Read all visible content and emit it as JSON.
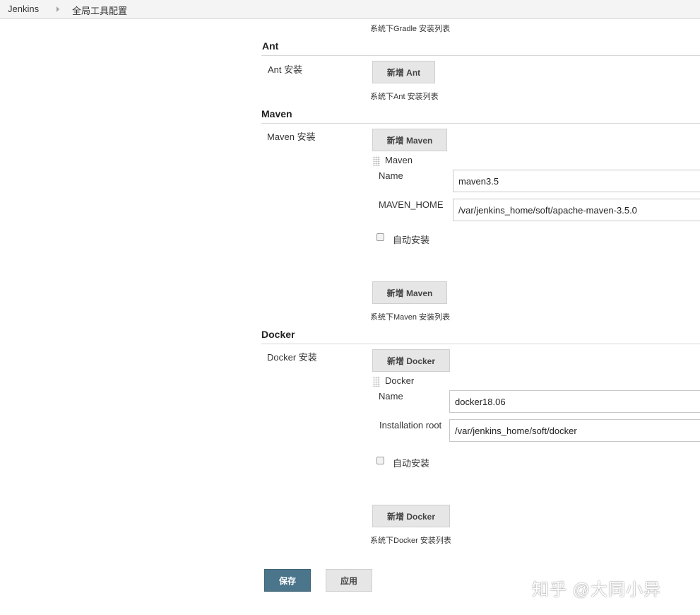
{
  "breadcrumb": {
    "items": [
      "Jenkins",
      "全局工具配置"
    ]
  },
  "gradle": {
    "hint": "系统下Gradle 安装列表"
  },
  "ant": {
    "title": "Ant",
    "install_label": "Ant 安装",
    "add_button": "新增 Ant",
    "hint": "系统下Ant 安装列表"
  },
  "maven": {
    "title": "Maven",
    "install_label": "Maven 安装",
    "add_button": "新增 Maven",
    "installation": {
      "title": "Maven",
      "name_label": "Name",
      "name_value": "maven3.5",
      "home_label": "MAVEN_HOME",
      "home_value": "/var/jenkins_home/soft/apache-maven-3.5.0",
      "auto_install_label": "自动安装"
    },
    "add_button_bottom": "新增 Maven",
    "hint": "系统下Maven 安装列表"
  },
  "docker": {
    "title": "Docker",
    "install_label": "Docker 安装",
    "add_button": "新增 Docker",
    "installation": {
      "title": "Docker",
      "name_label": "Name",
      "name_value": "docker18.06",
      "root_label": "Installation root",
      "root_value": "/var/jenkins_home/soft/docker",
      "auto_install_label": "自动安装"
    },
    "add_button_bottom": "新增 Docker",
    "hint": "系统下Docker 安装列表"
  },
  "footer": {
    "save_label": "保存",
    "apply_label": "应用"
  },
  "watermark": "知乎 @大同小异",
  "colors": {
    "primary_button": "#4b758b",
    "breadcrumb_bg": "#f4f4f4"
  }
}
